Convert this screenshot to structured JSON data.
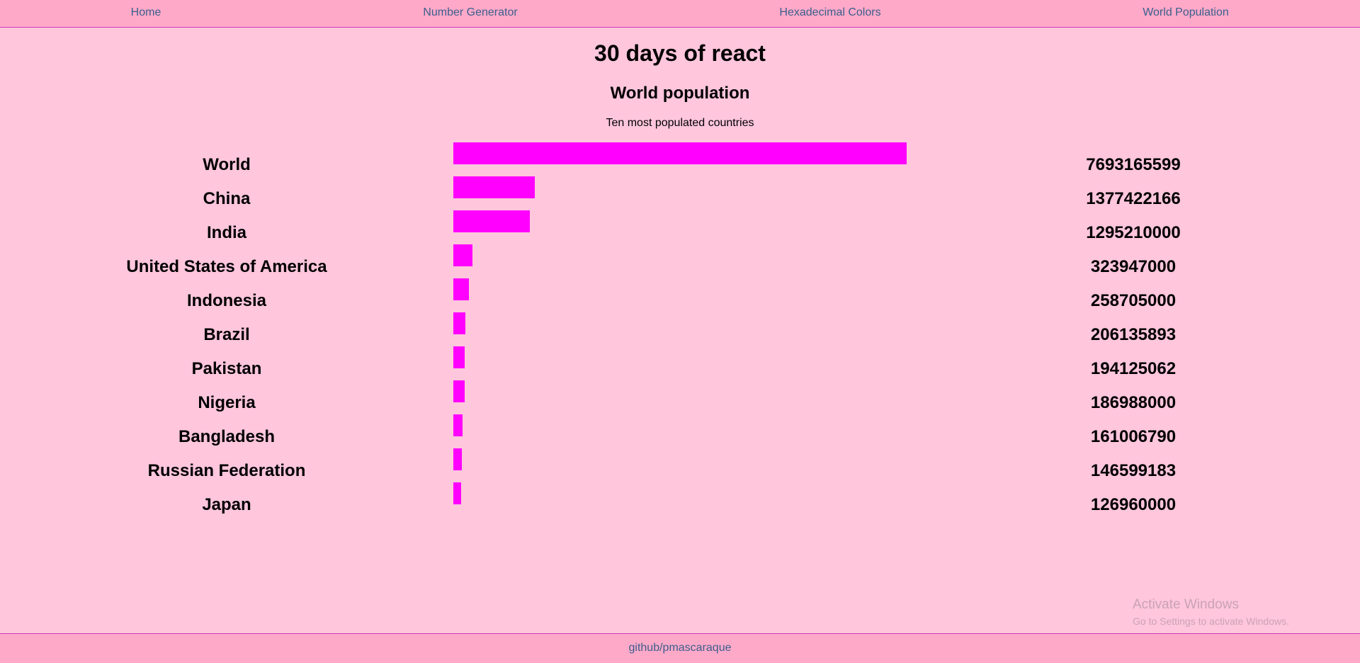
{
  "nav": {
    "items": [
      {
        "label": "Home"
      },
      {
        "label": "Number Generator"
      },
      {
        "label": "Hexadecimal Colors"
      },
      {
        "label": "World Population"
      }
    ]
  },
  "page": {
    "title": "30 days of react",
    "subtitle": "World population",
    "caption": "Ten most populated countries"
  },
  "chart_data": {
    "type": "bar",
    "orientation": "horizontal",
    "categories": [
      "World",
      "China",
      "India",
      "United States of America",
      "Indonesia",
      "Brazil",
      "Pakistan",
      "Nigeria",
      "Bangladesh",
      "Russian Federation",
      "Japan"
    ],
    "values": [
      7693165599,
      1377422166,
      1295210000,
      323947000,
      258705000,
      206135893,
      194125062,
      186988000,
      161006790,
      146599183,
      126960000
    ],
    "value_labels": [
      "7693165599",
      "1377422166",
      "1295210000",
      "323947000",
      "258705000",
      "206135893",
      "194125062",
      "186988000",
      "161006790",
      "146599183",
      "126960000"
    ],
    "bar_color": "#ff00ff",
    "xlim": [
      0,
      7693165599
    ]
  },
  "watermark": {
    "line1": "Activate Windows",
    "line2": "Go to Settings to activate Windows."
  },
  "footer": {
    "link": "github/pmascaraque"
  },
  "colors": {
    "background": "#ffc6dc",
    "nav_background": "#ffa9c9",
    "link": "#3a5f8c",
    "border": "#c83ab8"
  }
}
